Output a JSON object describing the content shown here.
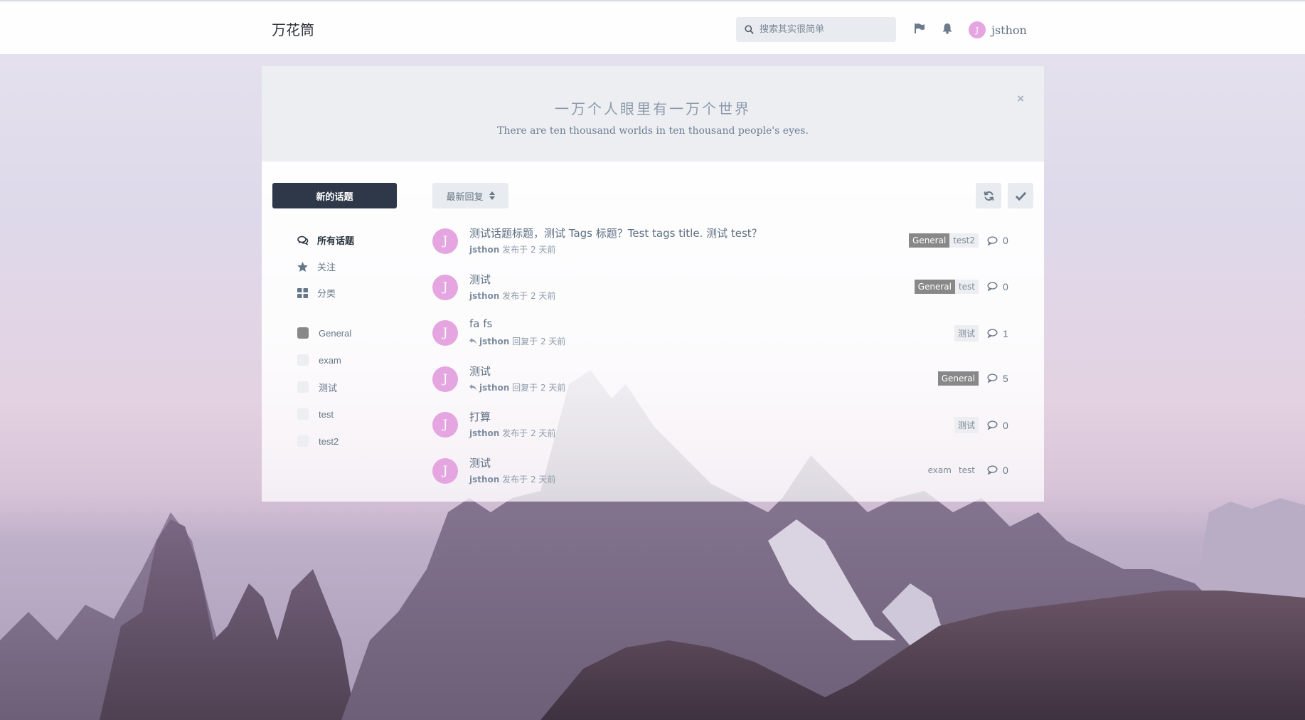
{
  "header": {
    "brand": "万花筒",
    "search_placeholder": "搜索其实很简单",
    "username": "jsthon",
    "avatar_letter": "J"
  },
  "hero": {
    "title": "一万个人眼里有一万个世界",
    "subtitle": "There are ten thousand worlds in ten thousand people's eyes.",
    "close": "×"
  },
  "sidebar": {
    "new_button": "新的话题",
    "nav": [
      {
        "label": "所有话题",
        "icon": "comments-icon"
      },
      {
        "label": "关注",
        "icon": "star-icon"
      },
      {
        "label": "分类",
        "icon": "grid-icon"
      }
    ],
    "tags": [
      {
        "label": "General",
        "color": "#888888"
      },
      {
        "label": "exam",
        "color": "#eceef2"
      },
      {
        "label": "测试",
        "color": "#eceef2"
      },
      {
        "label": "test",
        "color": "#eceef2"
      },
      {
        "label": "test2",
        "color": "#eceef2"
      }
    ]
  },
  "toolbar": {
    "sort_label": "最新回复"
  },
  "discussions": [
    {
      "avatar": "J",
      "title": "测试话题标题，测试 Tags 标题？Test tags title. 测试 test？",
      "user": "jsthon",
      "action": "发布于 2 天前",
      "replied": false,
      "tags": [
        {
          "label": "General",
          "style": "general"
        },
        {
          "label": "test2",
          "style": "tag"
        }
      ],
      "count": "0"
    },
    {
      "avatar": "J",
      "title": "测试",
      "user": "jsthon",
      "action": "发布于 2 天前",
      "replied": false,
      "tags": [
        {
          "label": "General",
          "style": "general"
        },
        {
          "label": "test",
          "style": "tag"
        }
      ],
      "count": "0"
    },
    {
      "avatar": "J",
      "title": "fa fs",
      "user": "jsthon",
      "action": "回复于 2 天前",
      "replied": true,
      "tags": [
        {
          "label": "测试",
          "style": "tag"
        }
      ],
      "count": "1"
    },
    {
      "avatar": "J",
      "title": "测试",
      "user": "jsthon",
      "action": "回复于 2 天前",
      "replied": true,
      "tags": [
        {
          "label": "General",
          "style": "general"
        }
      ],
      "count": "5"
    },
    {
      "avatar": "J",
      "title": "打算",
      "user": "jsthon",
      "action": "发布于 2 天前",
      "replied": false,
      "tags": [
        {
          "label": "测试",
          "style": "tag"
        }
      ],
      "count": "0"
    },
    {
      "avatar": "J",
      "title": "测试",
      "user": "jsthon",
      "action": "发布于 2 天前",
      "replied": false,
      "tags": [
        {
          "label": "exam",
          "style": "plain"
        },
        {
          "label": "test",
          "style": "plain"
        }
      ],
      "count": "0"
    }
  ]
}
